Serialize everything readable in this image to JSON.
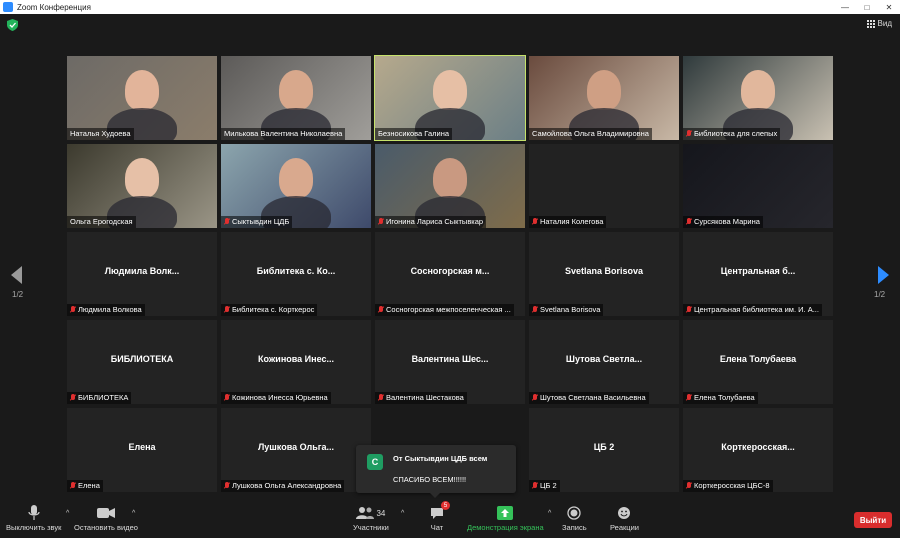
{
  "window": {
    "title": "Zoom Конференция"
  },
  "topbar": {
    "view_label": "Вид"
  },
  "nav": {
    "page_left": "1/2",
    "page_right": "1/2"
  },
  "participants": [
    {
      "tile": "Наталья Худоева",
      "video": true,
      "muted": false,
      "active": false
    },
    {
      "tile": "Милькова Валентина Николаевна",
      "video": true,
      "muted": false,
      "active": false
    },
    {
      "tile": "Безносикова Галина",
      "video": true,
      "muted": false,
      "active": true
    },
    {
      "tile": "Самойлова Ольга Владимировна",
      "video": true,
      "muted": false,
      "active": false
    },
    {
      "tile": "Библиотека для слепых",
      "video": true,
      "muted": true,
      "active": false
    },
    {
      "tile": "Ольга Ерогодская",
      "video": true,
      "muted": false,
      "active": false
    },
    {
      "tile": "Сыктывдин ЦДБ",
      "video": true,
      "muted": true,
      "active": false
    },
    {
      "tile": "Игонина Лариса Сыктывкар",
      "video": true,
      "muted": true,
      "active": false
    },
    {
      "tile": "Наталия Колегова",
      "video": true,
      "muted": true,
      "active": false
    },
    {
      "tile": "Сурсякова Марина",
      "video": true,
      "muted": true,
      "active": false
    },
    {
      "big": "Людмила Волк...",
      "tile": "Людмила Волкова",
      "video": false,
      "muted": true
    },
    {
      "big": "Библитека с. Ко...",
      "tile": "Библитека с. Корткерос",
      "video": false,
      "muted": true
    },
    {
      "big": "Сосногорская м...",
      "tile": "Сосногорская межпоселенческая ...",
      "video": false,
      "muted": true
    },
    {
      "big": "Svetlana Borisova",
      "tile": "Svetlana Borisova",
      "video": false,
      "muted": true
    },
    {
      "big": "Центральная б...",
      "tile": "Центральная библиотека им. И. А...",
      "video": false,
      "muted": true
    },
    {
      "big": "БИБЛИОТЕКА",
      "tile": "БИБЛИОТЕКА",
      "video": false,
      "muted": true
    },
    {
      "big": "Кожинова Инес...",
      "tile": "Кожинова Инесса Юрьевна",
      "video": false,
      "muted": true
    },
    {
      "big": "Валентина Шес...",
      "tile": "Валентина Шестакова",
      "video": false,
      "muted": true
    },
    {
      "big": "Шутова Светла...",
      "tile": "Шутова Светлана Васильевна",
      "video": false,
      "muted": true
    },
    {
      "big": "Елена Толубаева",
      "tile": "Елена Толубаева",
      "video": false,
      "muted": true
    },
    {
      "big": "Елена",
      "tile": "Елена",
      "video": false,
      "muted": true
    },
    {
      "big": "Лушкова Ольга...",
      "tile": "Лушкова Ольга Александровна",
      "video": false,
      "muted": true
    },
    {
      "big": "",
      "tile": "",
      "video": false,
      "muted": false
    },
    {
      "big": "ЦБ 2",
      "tile": "ЦБ 2",
      "video": false,
      "muted": true
    },
    {
      "big": "Корткеросская...",
      "tile": "Корткеросская ЦБС-8",
      "video": false,
      "muted": true
    }
  ],
  "chat_toast": {
    "avatar_letter": "С",
    "from": "От Сыктывдин ЦДБ всем",
    "message": "СПАСИБО ВСЕМ!!!!!!"
  },
  "toolbar": {
    "mute_label": "Выключить звук",
    "video_label": "Остановить видео",
    "participants_label": "Участники",
    "participants_count": "34",
    "chat_label": "Чат",
    "chat_badge": "5",
    "share_label": "Демонстрация экрана",
    "record_label": "Запись",
    "reactions_label": "Реакции",
    "leave_label": "Выйти"
  },
  "colors": {
    "active_speaker": "#c6e26b",
    "share_green": "#35c25a",
    "leave_red": "#d92d2d",
    "muted_red": "#e02f2f"
  }
}
